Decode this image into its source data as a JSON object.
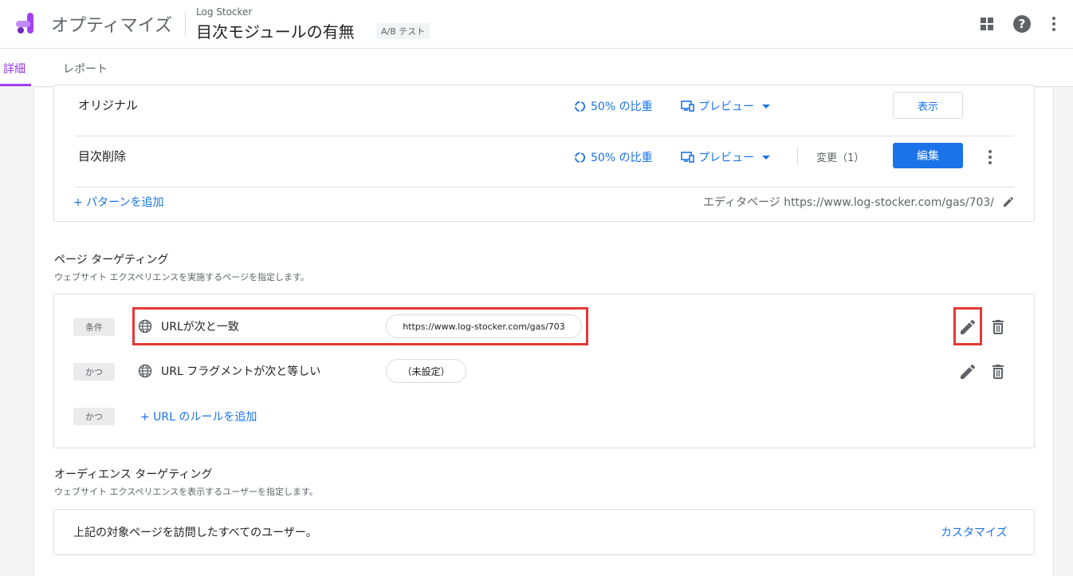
{
  "header": {
    "app_name": "オプティマイズ",
    "account_name": "Log Stocker",
    "experiment_title": "目次モジュールの有無",
    "experiment_type": "A/B テスト"
  },
  "tabs": [
    {
      "label": "詳細",
      "active": true
    },
    {
      "label": "レポート",
      "active": false
    }
  ],
  "variants": [
    {
      "name": "オリジナル",
      "weight": "50% の比重",
      "preview": "プレビュー",
      "action": "表示"
    },
    {
      "name": "目次削除",
      "weight": "50% の比重",
      "preview": "プレビュー",
      "changes": "変更（1）",
      "action": "編集"
    }
  ],
  "variants_footer": {
    "add_variant": "+ パターンを追加",
    "editor_page": "エディタページ https://www.log-stocker.com/gas/703/"
  },
  "page_targeting": {
    "title": "ページ ターゲティング",
    "subtitle": "ウェブサイト エクスペリエンスを実施するページを指定します。",
    "rules": [
      {
        "chip": "条件",
        "label": "URLが次と一致",
        "value": "https://www.log-stocker.com/gas/703"
      },
      {
        "chip": "かつ",
        "label": "URL フラグメントが次と等しい",
        "value": "（未設定）"
      }
    ],
    "add_chip": "かつ",
    "add_rule": "+ URL のルールを追加"
  },
  "audience_targeting": {
    "title": "オーディエンス ターゲティング",
    "subtitle": "ウェブサイト エクスペリエンスを表示するユーザーを指定します。",
    "text": "上記の対象ページを訪問したすべてのユーザー。",
    "customize": "カスタマイズ"
  },
  "colors": {
    "accent": "#1a73e8",
    "tab_active": "#9334e6",
    "highlight": "#e53935"
  }
}
